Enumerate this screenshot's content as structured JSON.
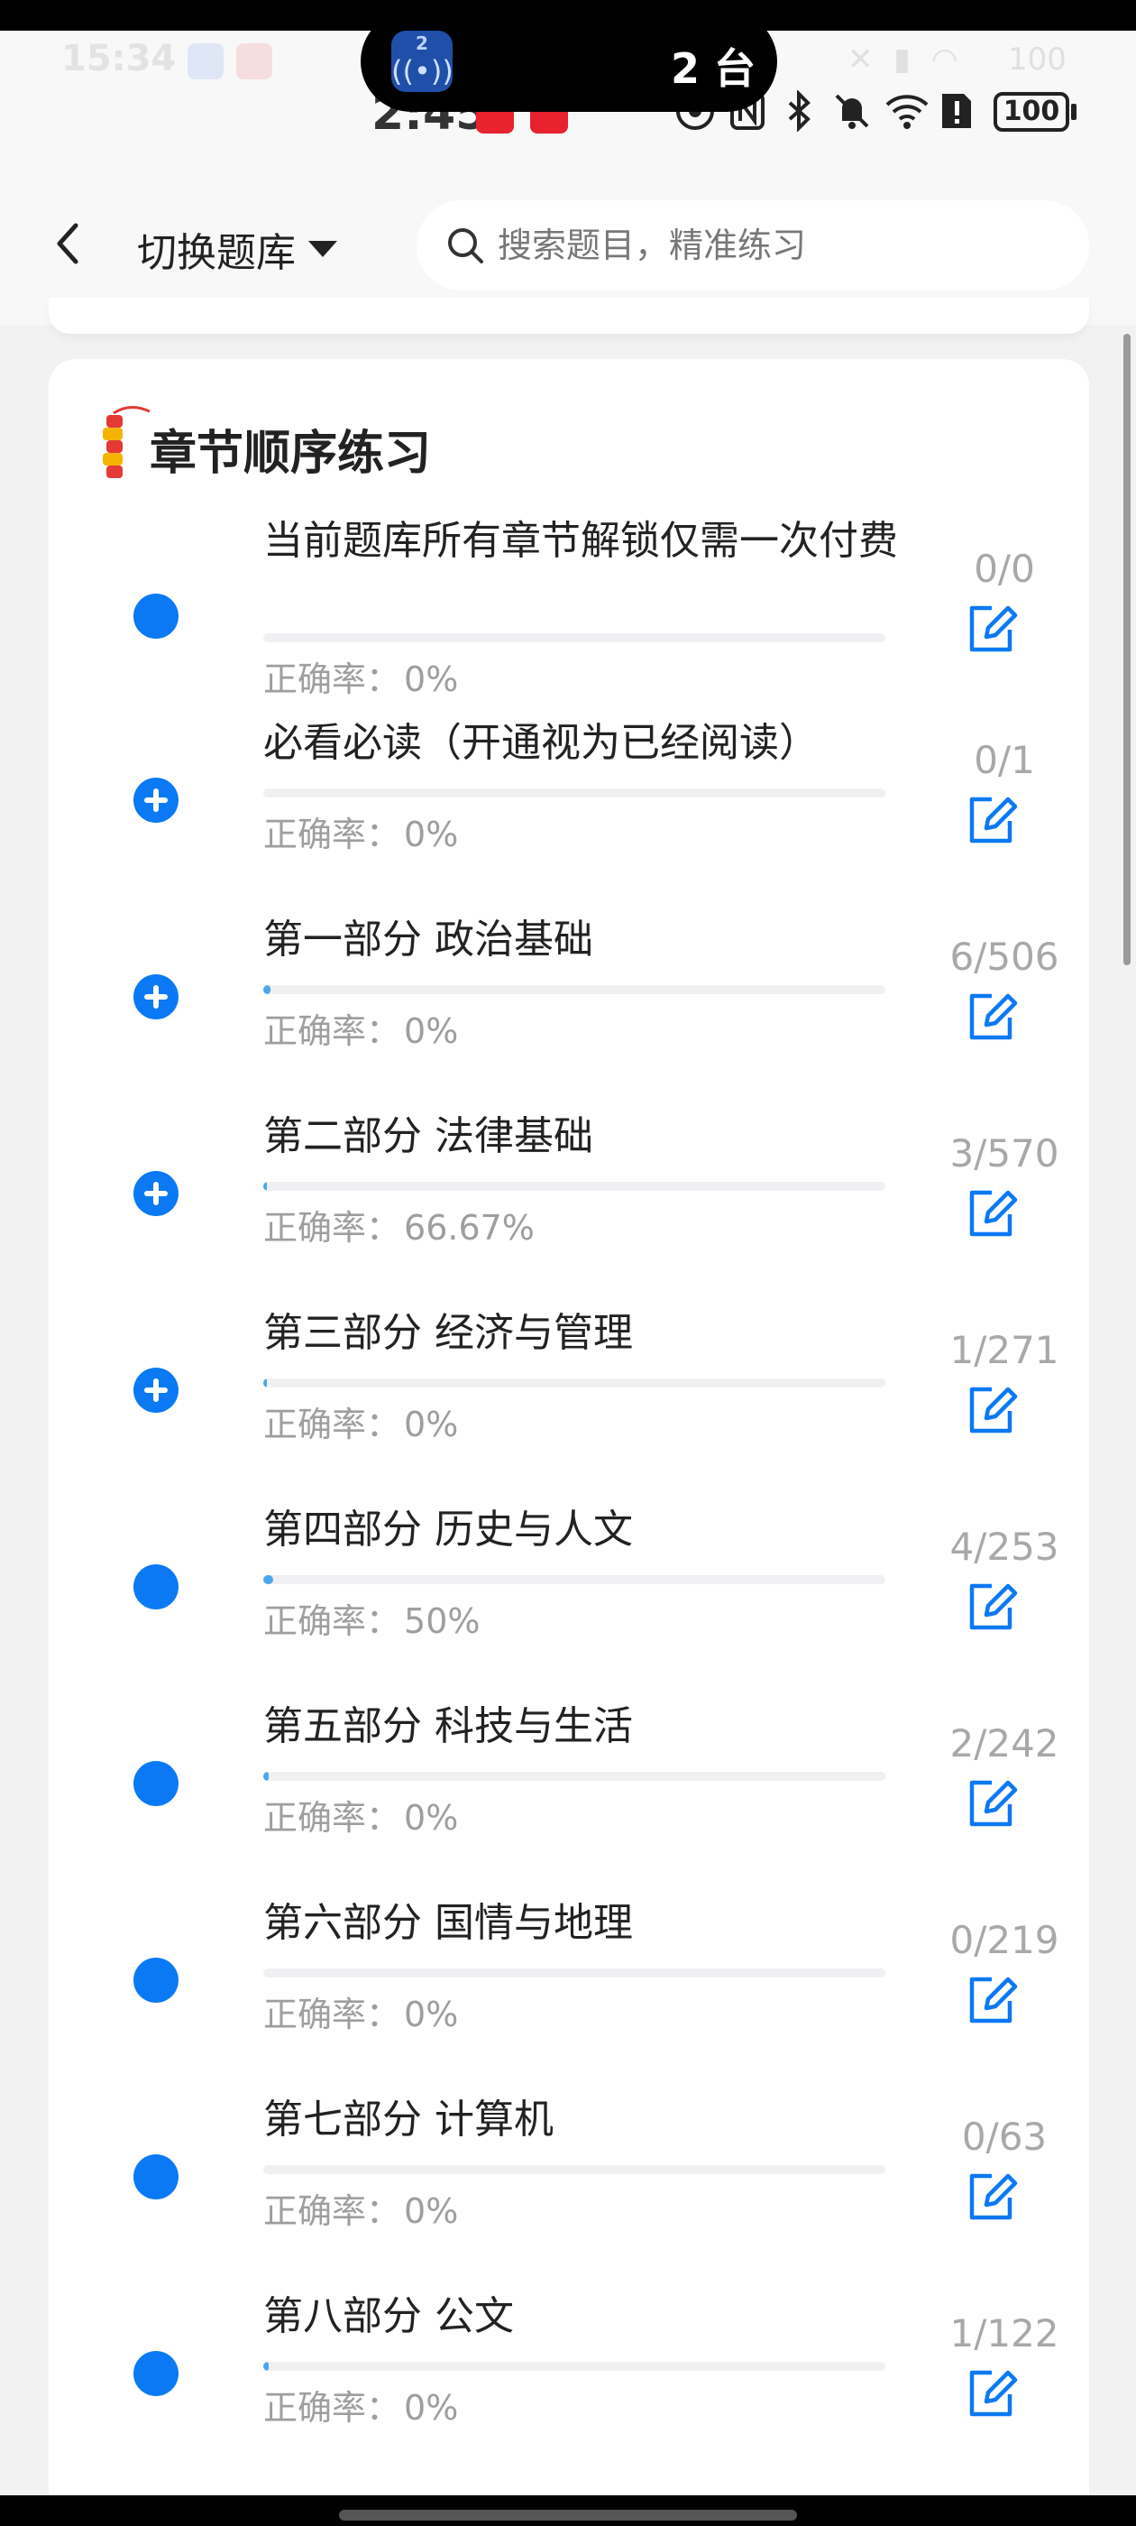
{
  "status_bar": {
    "ghost_time": "15:34",
    "ghost_battery": "100",
    "time": "2:45",
    "battery": "100",
    "island_badge": "2",
    "island_text": "2 台"
  },
  "header": {
    "back_icon": "chevron-left-icon",
    "switch_label": "切换题库",
    "search_placeholder": "搜索题目，精准练习"
  },
  "card": {
    "title": "章节顺序练习",
    "accuracy_label": "正确率：",
    "chapters": [
      {
        "name": "当前题库所有章节解锁仅需一次付费",
        "count": "0/0",
        "accuracy": "0%",
        "progress": 0,
        "expandable": false
      },
      {
        "name": "必看必读（开通视为已经阅读）",
        "count": "0/1",
        "accuracy": "0%",
        "progress": 0,
        "expandable": true
      },
      {
        "name": "第一部分 政治基础",
        "count": "6/506",
        "accuracy": "0%",
        "progress": 0.012,
        "expandable": true
      },
      {
        "name": "第二部分 法律基础",
        "count": "3/570",
        "accuracy": "66.67%",
        "progress": 0.005,
        "expandable": true
      },
      {
        "name": "第三部分 经济与管理",
        "count": "1/271",
        "accuracy": "0%",
        "progress": 0.004,
        "expandable": true
      },
      {
        "name": "第四部分 历史与人文",
        "count": "4/253",
        "accuracy": "50%",
        "progress": 0.016,
        "expandable": false
      },
      {
        "name": "第五部分 科技与生活",
        "count": "2/242",
        "accuracy": "0%",
        "progress": 0.008,
        "expandable": false
      },
      {
        "name": "第六部分 国情与地理",
        "count": "0/219",
        "accuracy": "0%",
        "progress": 0,
        "expandable": false
      },
      {
        "name": "第七部分 计算机",
        "count": "0/63",
        "accuracy": "0%",
        "progress": 0,
        "expandable": false
      },
      {
        "name": "第八部分 公文",
        "count": "1/122",
        "accuracy": "0%",
        "progress": 0.008,
        "expandable": false
      }
    ]
  },
  "colors": {
    "accent": "#0b79f4",
    "progress": "#4aa6ee",
    "muted_text": "#9e9e9e"
  }
}
